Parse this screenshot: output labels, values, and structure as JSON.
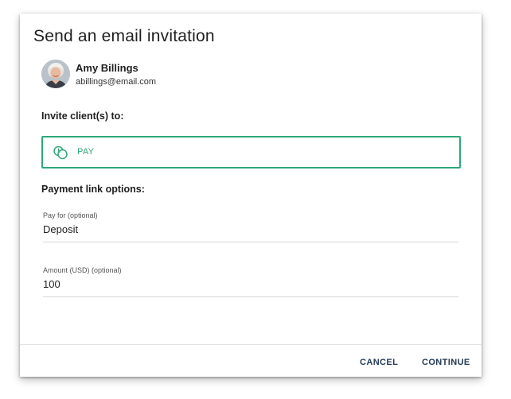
{
  "dialog": {
    "title": "Send an email invitation"
  },
  "user": {
    "name": "Amy Billings",
    "email": "abillings@email.com",
    "avatar": "avatar-photo"
  },
  "invite": {
    "label": "Invite client(s) to:",
    "option_label": "PAY",
    "option_icon": "coins-icon",
    "accent_color": "#2ea879"
  },
  "payment": {
    "label": "Payment link options:",
    "pay_for": {
      "label": "Pay for (optional)",
      "value": "Deposit"
    },
    "amount": {
      "label": "Amount (USD) (optional)",
      "value": "100"
    }
  },
  "actions": {
    "cancel_label": "CANCEL",
    "continue_label": "CONTINUE"
  }
}
